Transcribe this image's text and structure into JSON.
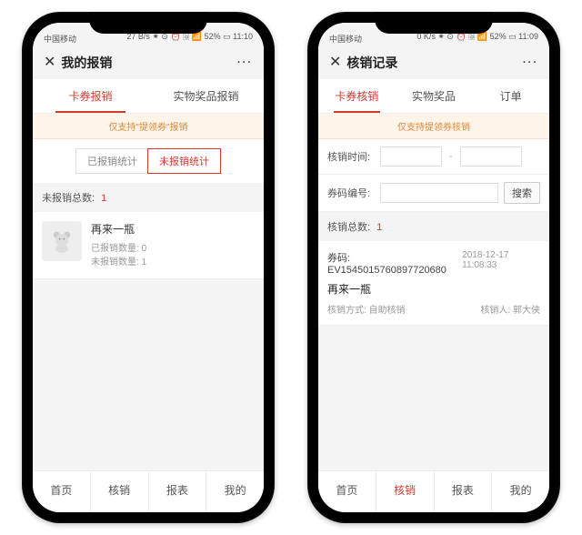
{
  "colors": {
    "accent": "#d23b2e",
    "banner_bg": "#fff4e8",
    "banner_fg": "#e0893b"
  },
  "phone1": {
    "status": {
      "carrier": "中国移动",
      "indicators": "27 B/s ⁕ ⊙ ⏰ 🗟 📶 52% ▭ 11:10"
    },
    "title": "我的报销",
    "more_glyph": "···",
    "tabs": [
      "卡券报销",
      "实物奖品报销"
    ],
    "active_tab_index": 0,
    "banner": "仅支持\"提领券\"报销",
    "segments": [
      "已报销统计",
      "未报销统计"
    ],
    "active_segment_index": 1,
    "count_label": "未报销总数:",
    "count_value": "1",
    "item": {
      "thumb_icon": "teddy-bear",
      "title": "再来一瓶",
      "line1_label": "已报销数量:",
      "line1_value": "0",
      "line2_label": "未报销数量:",
      "line2_value": "1"
    },
    "bottom_tabs": [
      "首页",
      "核销",
      "报表",
      "我的"
    ],
    "bottom_active_index": -1
  },
  "phone2": {
    "status": {
      "carrier": "中国移动",
      "indicators": "0 K/s ⁕ ⊙ ⏰ 🗟 📶 52% ▭ 11:09"
    },
    "title": "核销记录",
    "more_glyph": "···",
    "tabs": [
      "卡券核销",
      "实物奖品",
      "订单"
    ],
    "active_tab_index": 0,
    "banner": "仅支持提领券核销",
    "filter_time_label": "核销时间:",
    "filter_time_dash": "-",
    "filter_code_label": "券码编号:",
    "search_button": "搜索",
    "count_label": "核销总数:",
    "count_value": "1",
    "record": {
      "code_label": "券码:",
      "code_value": "EV1545015760897720680",
      "timestamp": "2018-12-17 11:08:33",
      "title": "再来一瓶",
      "method_label": "核销方式:",
      "method_value": "自助核销",
      "person_label": "核销人:",
      "person_value": "郭大侠"
    },
    "bottom_tabs": [
      "首页",
      "核销",
      "报表",
      "我的"
    ],
    "bottom_active_index": 1
  }
}
